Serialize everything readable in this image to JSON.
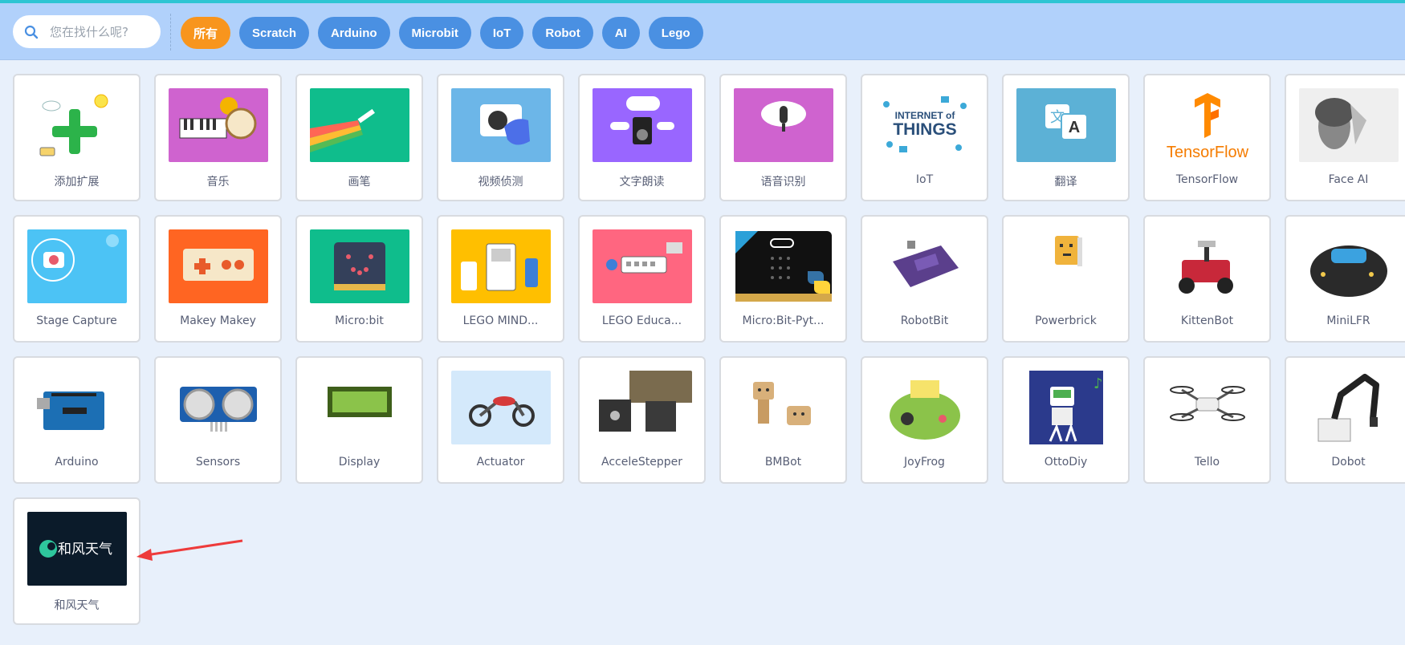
{
  "search": {
    "placeholder": "您在找什么呢?"
  },
  "tags": [
    {
      "label": "所有",
      "active": true
    },
    {
      "label": "Scratch"
    },
    {
      "label": "Arduino"
    },
    {
      "label": "Microbit"
    },
    {
      "label": "IoT"
    },
    {
      "label": "Robot"
    },
    {
      "label": "AI"
    },
    {
      "label": "Lego"
    }
  ],
  "extensions": [
    {
      "label": "添加扩展",
      "icon": "add-extension-icon"
    },
    {
      "label": "音乐",
      "icon": "music-icon"
    },
    {
      "label": "画笔",
      "icon": "pen-icon"
    },
    {
      "label": "视频侦测",
      "icon": "video-sensing-icon"
    },
    {
      "label": "文字朗读",
      "icon": "text-to-speech-icon"
    },
    {
      "label": "语音识别",
      "icon": "speech-recognition-icon"
    },
    {
      "label": "IoT",
      "icon": "internet-of-things-icon",
      "image_text": [
        "INTERNET of",
        "THINGS"
      ]
    },
    {
      "label": "翻译",
      "icon": "translate-icon"
    },
    {
      "label": "TensorFlow",
      "icon": "tensorflow-icon",
      "image_text": "TensorFlow"
    },
    {
      "label": "Face AI",
      "icon": "face-ai-icon"
    },
    {
      "label": "Stage Capture",
      "icon": "stage-capture-icon"
    },
    {
      "label": "Makey Makey",
      "icon": "makey-makey-icon"
    },
    {
      "label": "Micro:bit",
      "icon": "microbit-icon"
    },
    {
      "label": "LEGO MIND...",
      "icon": "lego-mindstorms-icon"
    },
    {
      "label": "LEGO Educa...",
      "icon": "lego-education-icon"
    },
    {
      "label": "Micro:Bit-Pyt...",
      "icon": "microbit-python-icon"
    },
    {
      "label": "RobotBit",
      "icon": "robotbit-icon"
    },
    {
      "label": "Powerbrick",
      "icon": "powerbrick-icon"
    },
    {
      "label": "KittenBot",
      "icon": "kittenbot-icon"
    },
    {
      "label": "MiniLFR",
      "icon": "minilfr-icon"
    },
    {
      "label": "Arduino",
      "icon": "arduino-board-icon"
    },
    {
      "label": "Sensors",
      "icon": "ultrasonic-sensor-icon"
    },
    {
      "label": "Display",
      "icon": "lcd-display-icon"
    },
    {
      "label": "Actuator",
      "icon": "motorcycle-icon"
    },
    {
      "label": "AcceleStepper",
      "icon": "stepper-motor-icon"
    },
    {
      "label": "BMBot",
      "icon": "bmbot-icon"
    },
    {
      "label": "JoyFrog",
      "icon": "joyfrog-icon"
    },
    {
      "label": "OttoDiy",
      "icon": "ottodiy-icon"
    },
    {
      "label": "Tello",
      "icon": "drone-icon"
    },
    {
      "label": "Dobot",
      "icon": "robot-arm-icon"
    },
    {
      "label": "和风天气",
      "icon": "qweather-logo-icon",
      "image_text": "和风天气"
    }
  ],
  "colors": {
    "header": "#b1d1fb",
    "page": "#e8f0fb",
    "tag": "#4a90e2",
    "tag_active": "#f8951d",
    "arrow": "#ee3b3b"
  }
}
